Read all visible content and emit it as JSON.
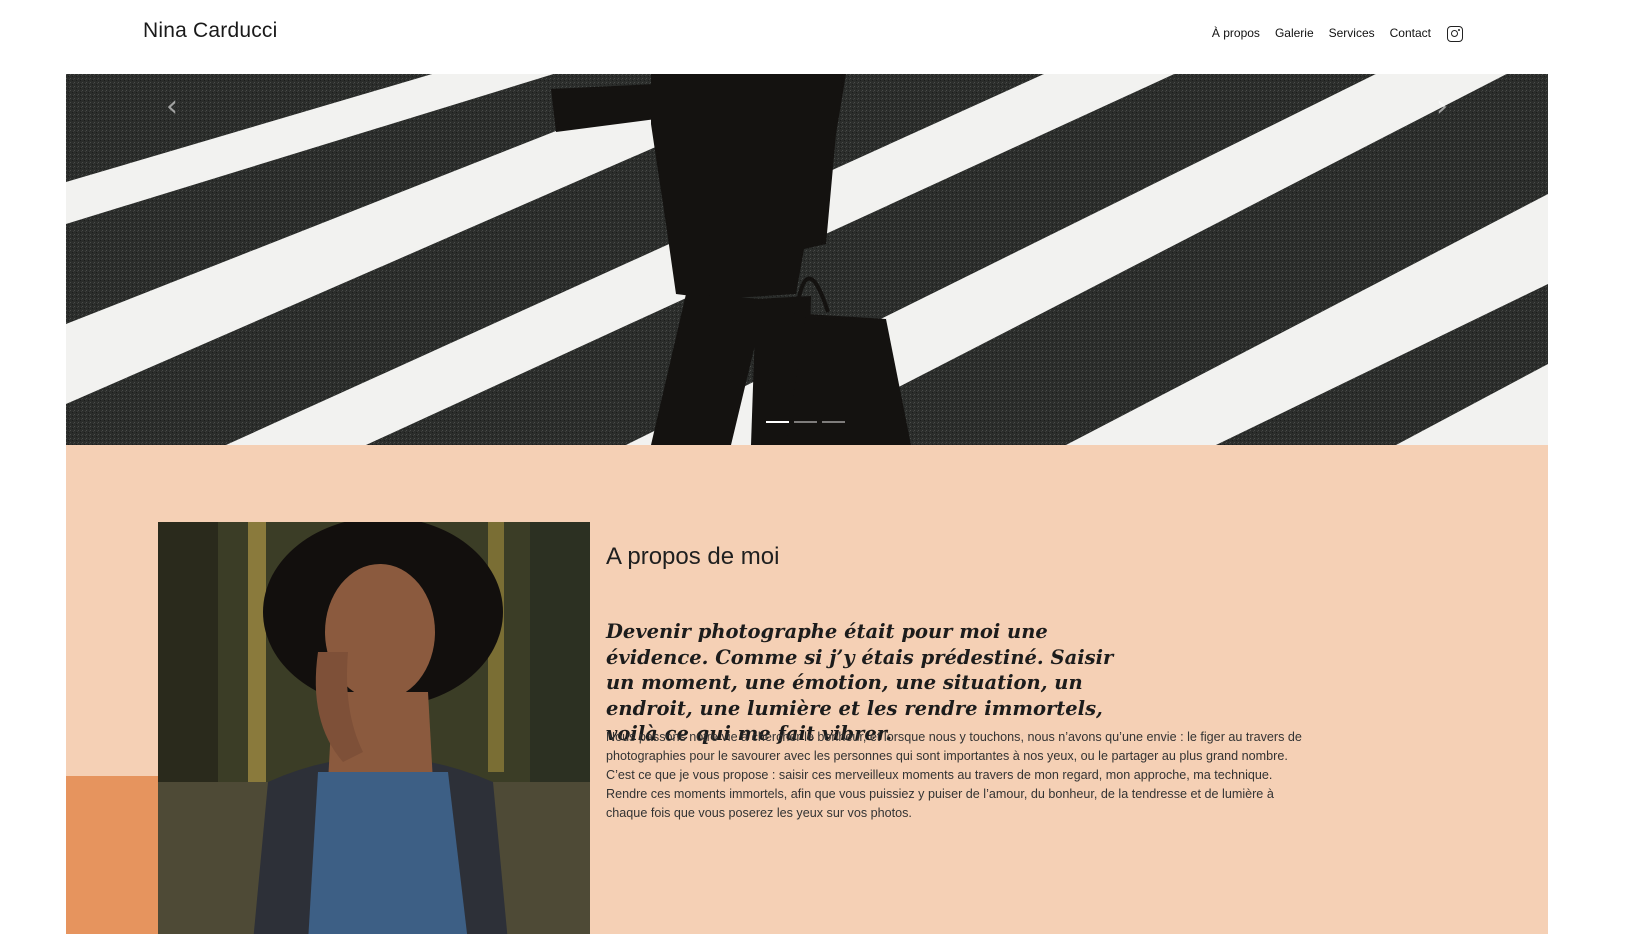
{
  "header": {
    "logo": "Nina Carducci",
    "nav": [
      "À propos",
      "Galerie",
      "Services",
      "Contact"
    ],
    "instagram_icon": "instagram-icon"
  },
  "carousel": {
    "prev_icon": "chevron-left-icon",
    "next_icon": "chevron-right-icon",
    "indicators": 3,
    "active_index": 0
  },
  "about": {
    "title": "A propos de moi",
    "quote": "Devenir photographe était pour moi une évidence. Comme si j’y étais prédestiné. Saisir un moment, une émotion, une situation, un endroit, une lumière et les rendre immortels, voilà ce qui me fait vibrer.",
    "text": "Nous passons notre vie à chercher le bonheur, et lorsque nous y touchons, nous n’avons qu’une envie : le figer au travers de photographies pour le savourer avec les personnes qui sont importantes à nos yeux, ou le partager au plus grand nombre. C’est ce que je vous propose : saisir ces merveilleux moments au travers de mon regard, mon approche, ma technique. Rendre ces moments immortels, afin que vous puissiez y puiser de l’amour, du bonheur, de la tendresse et de lumière à chaque fois que vous poserez les yeux sur vos photos."
  },
  "colors": {
    "about_bg": "#f5d0b5",
    "accent": "#e6945e"
  }
}
